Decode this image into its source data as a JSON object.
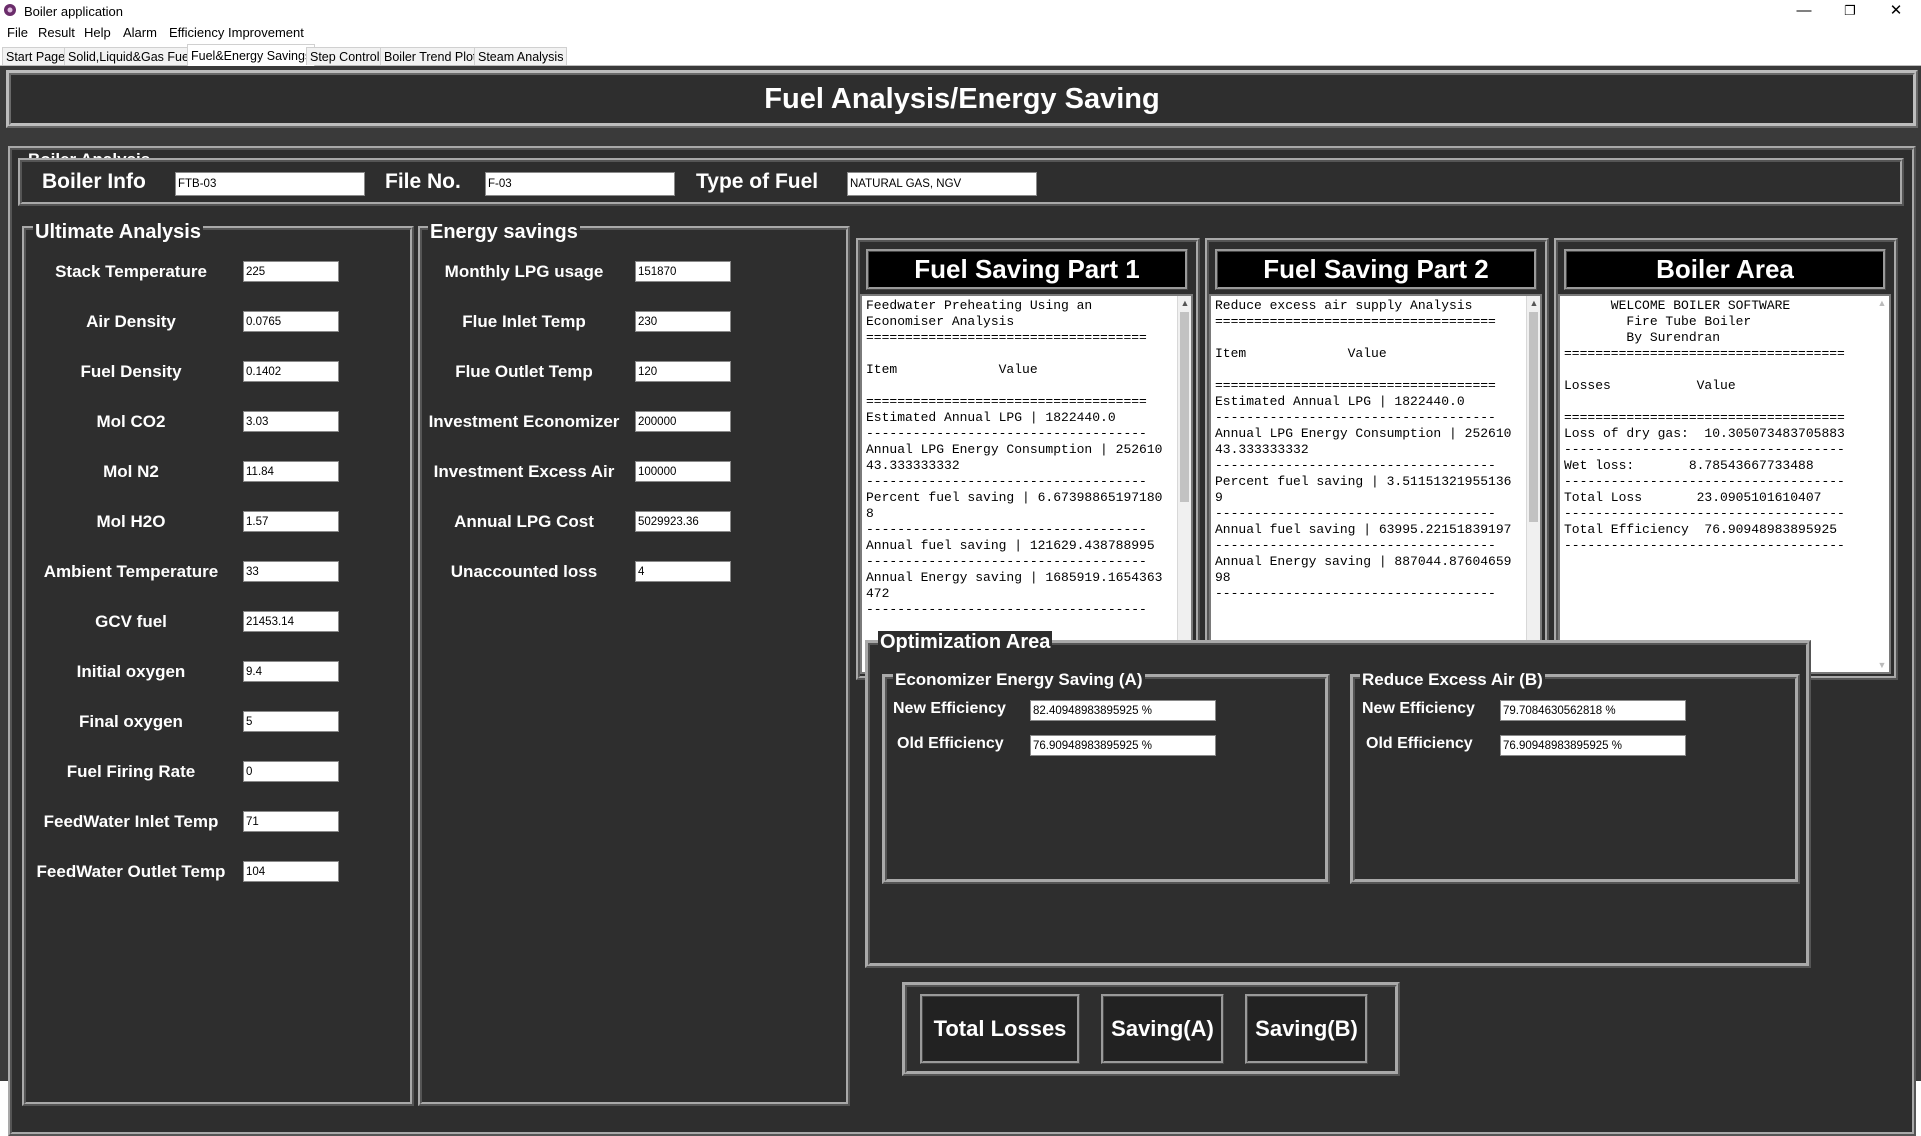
{
  "window": {
    "title": "Boiler application",
    "controls": {
      "minimize": "—",
      "maximize": "❐",
      "close": "✕"
    }
  },
  "menu": [
    "File",
    "Result",
    "Help",
    "Alarm",
    "Efficiency Improvement"
  ],
  "tabs": [
    "Start Page",
    "Solid,Liquid&Gas Fuel",
    "Fuel&Energy Savings",
    "Step Control",
    "Boiler Trend Plot",
    "Steam Analysis"
  ],
  "active_tab": "Fuel&Energy Savings",
  "header": {
    "title": "Fuel Analysis/Energy Saving"
  },
  "boiler_analysis": {
    "group_title": "Boiler Analysis",
    "boiler_info_label": "Boiler Info",
    "boiler_info_value": "FTB-03",
    "file_no_label": "File No.",
    "file_no_value": "F-03",
    "fuel_type_label": "Type of Fuel",
    "fuel_type_value": "NATURAL GAS, NGV"
  },
  "ultimate_analysis": {
    "group_title": "Ultimate Analysis",
    "fields": [
      {
        "label": "Stack Temperature",
        "value": "225"
      },
      {
        "label": "Air Density",
        "value": "0.0765"
      },
      {
        "label": "Fuel Density",
        "value": "0.1402"
      },
      {
        "label": "Mol CO2",
        "value": "3.03"
      },
      {
        "label": "Mol  N2",
        "value": "11.84"
      },
      {
        "label": "Mol H2O",
        "value": "1.57"
      },
      {
        "label": "Ambient Temperature",
        "value": "33"
      },
      {
        "label": "GCV fuel",
        "value": "21453.14"
      },
      {
        "label": "Initial oxygen",
        "value": "9.4"
      },
      {
        "label": "Final oxygen",
        "value": "5"
      },
      {
        "label": "Fuel Firing Rate",
        "value": "0"
      },
      {
        "label": "FeedWater Inlet Temp",
        "value": "71"
      },
      {
        "label": "FeedWater Outlet Temp",
        "value": "104"
      }
    ]
  },
  "energy_savings": {
    "group_title": "Energy savings",
    "fields": [
      {
        "label": "Monthly LPG usage",
        "value": "151870"
      },
      {
        "label": "Flue Inlet Temp",
        "value": "230"
      },
      {
        "label": "Flue Outlet Temp",
        "value": "120"
      },
      {
        "label": "Investment Economizer",
        "value": "200000"
      },
      {
        "label": "Investment Excess Air",
        "value": "100000"
      },
      {
        "label": "Annual LPG Cost",
        "value": "5029923.36"
      },
      {
        "label": "Unaccounted loss",
        "value": "4"
      }
    ]
  },
  "fuel_saving_1": {
    "title": "Fuel Saving Part 1",
    "text": "Feedwater Preheating Using an\nEconomiser Analysis\n====================================\n\nItem             Value\n\n====================================\nEstimated Annual LPG | 1822440.0\n------------------------------------\nAnnual LPG Energy Consumption | 252610\n43.333333332\n------------------------------------\nPercent fuel saving | 6.67398865197180\n8\n------------------------------------\nAnnual fuel saving | 121629.438788995\n------------------------------------\nAnnual Energy saving | 1685919.1654363\n472\n------------------------------------"
  },
  "fuel_saving_2": {
    "title": "Fuel Saving Part 2",
    "text": "Reduce excess air supply Analysis\n====================================\n\nItem             Value\n\n====================================\nEstimated Annual LPG | 1822440.0\n------------------------------------\nAnnual LPG Energy Consumption | 252610\n43.333333332\n------------------------------------\nPercent fuel saving | 3.51151321955136\n9\n------------------------------------\nAnnual fuel saving | 63995.22151839197\n------------------------------------\nAnnual Energy saving | 887044.87604659\n98\n------------------------------------"
  },
  "boiler_area": {
    "title": "Boiler Area",
    "text": "      WELCOME BOILER SOFTWARE\n        Fire Tube Boiler\n        By Surendran\n====================================\n\nLosses           Value\n\n====================================\nLoss of dry gas:  10.305073483705883\n------------------------------------\nWet loss:       8.78543667733488\n------------------------------------\nTotal Loss       23.0905101610407\n------------------------------------\nTotal Efficiency  76.90948983895925\n------------------------------------"
  },
  "optimization": {
    "group_title": "Optimization Area",
    "economizer": {
      "title": "Economizer Energy Saving (A)",
      "new_label": "New Efficiency",
      "new_value": "82.40948983895925 %",
      "old_label": "Old Efficiency",
      "old_value": "76.90948983895925 %"
    },
    "excess_air": {
      "title": "Reduce Excess Air (B)",
      "new_label": "New Efficiency",
      "new_value": "79.7084630562818 %",
      "old_label": "Old Efficiency",
      "old_value": "76.90948983895925 %"
    }
  },
  "buttons": {
    "total_losses": "Total Losses",
    "saving_a": "Saving(A)",
    "saving_b": "Saving(B)"
  }
}
